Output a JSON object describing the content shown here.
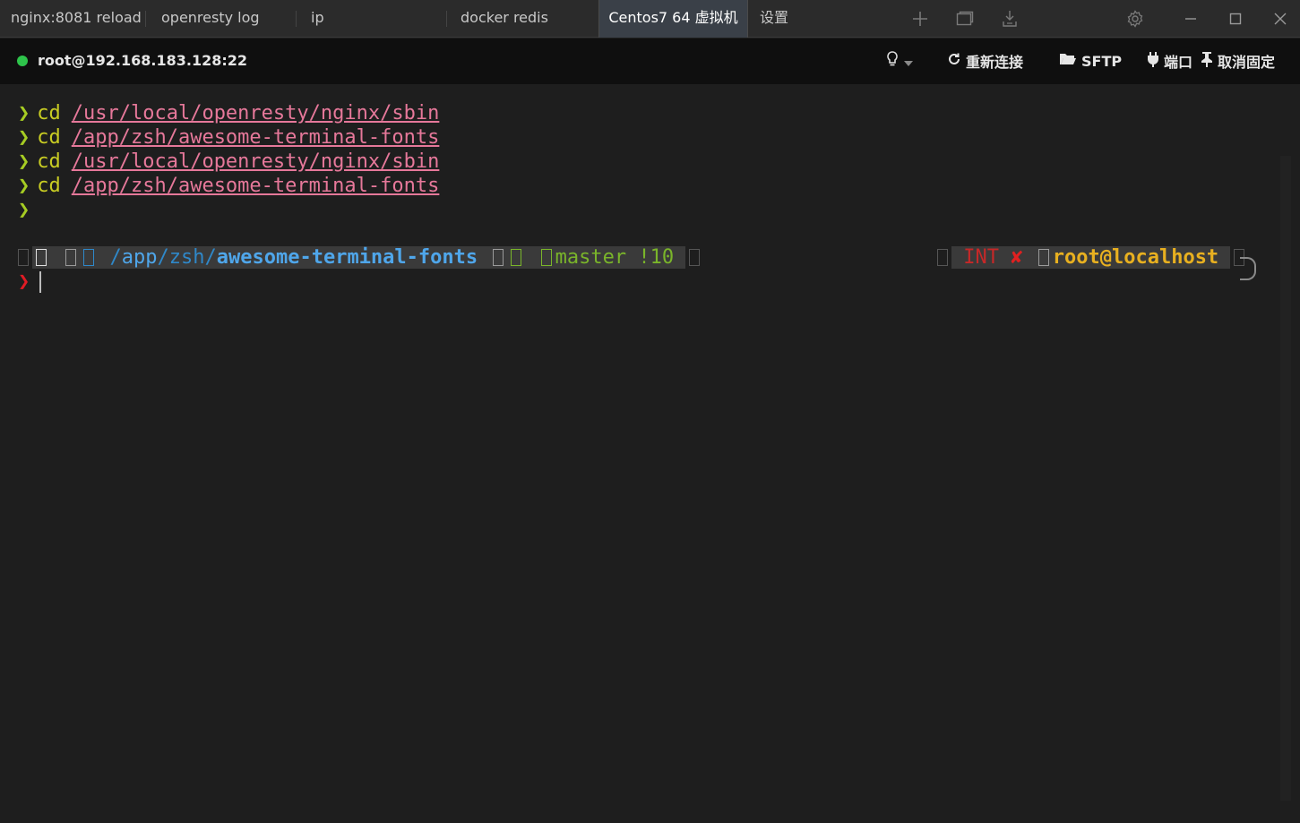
{
  "tabs": [
    {
      "label": "nginx:8081 reload",
      "active": false
    },
    {
      "label": "openresty log",
      "active": false
    },
    {
      "label": "ip",
      "active": false
    },
    {
      "label": "docker redis",
      "active": false
    },
    {
      "label": "Centos7 64 虚拟机",
      "active": true
    },
    {
      "label": "设置",
      "active": false
    }
  ],
  "toolbar_icons": [
    "plus-icon",
    "window-copy-icon",
    "download-icon",
    "gear-icon"
  ],
  "window_controls": [
    "minimize-icon",
    "maximize-icon",
    "close-icon"
  ],
  "session": {
    "status_color": "#2ec44b",
    "host": "root@192.168.183.128:22",
    "reconnect_label": "重新连接",
    "sftp_label": "SFTP",
    "port_label": "端口",
    "unpin_label": "取消固定"
  },
  "terminal": {
    "history": [
      {
        "prompt": "❯",
        "cmd": "cd",
        "path": "/usr/local/openresty/nginx/sbin"
      },
      {
        "prompt": "❯",
        "cmd": "cd",
        "path": "/app/zsh/awesome-terminal-fonts"
      },
      {
        "prompt": "❯",
        "cmd": "cd",
        "path": "/usr/local/openresty/nginx/sbin"
      },
      {
        "prompt": "❯",
        "cmd": "cd",
        "path": "/app/zsh/awesome-terminal-fonts"
      }
    ],
    "empty_prompt": "❯",
    "prompt_bar": {
      "dir_prefix1": "/",
      "dir_app": "app",
      "dir_slash": "/",
      "dir_zsh": "zsh",
      "dir_slash2": "/",
      "dir_current": "awesome-terminal-fonts",
      "git_branch": "master !10",
      "exit_status": "INT",
      "exit_mark": "✘",
      "user_host": "root@localhost"
    },
    "current_prompt": "❯",
    "colors": {
      "prompt_green": "#a6cc23",
      "path_pink": "#e6789a",
      "dir_blue": "#4fa6ea",
      "error_red": "#e01b24",
      "user_yellow": "#e8b020"
    }
  }
}
